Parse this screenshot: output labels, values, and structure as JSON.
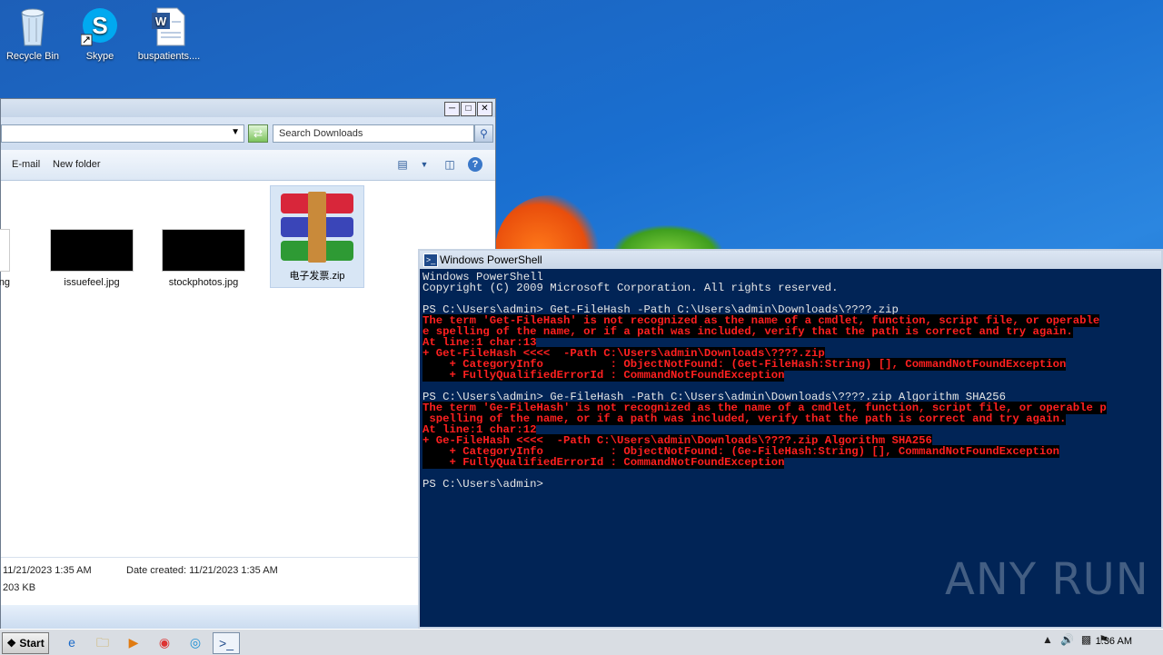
{
  "desktop": {
    "icons": [
      {
        "label": "Recycle Bin"
      },
      {
        "label": "Skype"
      },
      {
        "label": "buspatients...."
      }
    ]
  },
  "explorer": {
    "search_placeholder": "Search Downloads",
    "toolbar": {
      "email": "E-mail",
      "new_folder": "New folder"
    },
    "files": [
      {
        "name": "ng"
      },
      {
        "name": "issuefeel.jpg"
      },
      {
        "name": "stockphotos.jpg"
      },
      {
        "name": "电子发票.zip"
      }
    ],
    "details": {
      "date_modified": "11/21/2023 1:35 AM",
      "date_created": "Date created: 11/21/2023 1:35 AM",
      "size": "203 KB"
    }
  },
  "powershell": {
    "title": "Windows PowerShell",
    "lines": [
      {
        "text": "Windows PowerShell",
        "err": false
      },
      {
        "text": "Copyright (C) 2009 Microsoft Corporation. All rights reserved.",
        "err": false
      },
      {
        "text": "",
        "err": false
      },
      {
        "text": "PS C:\\Users\\admin> Get-FileHash -Path C:\\Users\\admin\\Downloads\\????.zip",
        "err": false
      },
      {
        "text": "The term 'Get-FileHash' is not recognized as the name of a cmdlet, function, script file, or operable",
        "err": true
      },
      {
        "text": "e spelling of the name, or if a path was included, verify that the path is correct and try again.",
        "err": true
      },
      {
        "text": "At line:1 char:13",
        "err": true
      },
      {
        "text": "+ Get-FileHash <<<<  -Path C:\\Users\\admin\\Downloads\\????.zip",
        "err": true
      },
      {
        "text": "    + CategoryInfo          : ObjectNotFound: (Get-FileHash:String) [], CommandNotFoundException",
        "err": true
      },
      {
        "text": "    + FullyQualifiedErrorId : CommandNotFoundException",
        "err": true
      },
      {
        "text": "",
        "err": false
      },
      {
        "text": "PS C:\\Users\\admin> Ge-FileHash -Path C:\\Users\\admin\\Downloads\\????.zip Algorithm SHA256",
        "err": false
      },
      {
        "text": "The term 'Ge-FileHash' is not recognized as the name of a cmdlet, function, script file, or operable p",
        "err": true
      },
      {
        "text": " spelling of the name, or if a path was included, verify that the path is correct and try again.",
        "err": true
      },
      {
        "text": "At line:1 char:12",
        "err": true
      },
      {
        "text": "+ Ge-FileHash <<<<  -Path C:\\Users\\admin\\Downloads\\????.zip Algorithm SHA256",
        "err": true
      },
      {
        "text": "    + CategoryInfo          : ObjectNotFound: (Ge-FileHash:String) [], CommandNotFoundException",
        "err": true
      },
      {
        "text": "    + FullyQualifiedErrorId : CommandNotFoundException",
        "err": true
      },
      {
        "text": "",
        "err": false
      },
      {
        "text": "PS C:\\Users\\admin>",
        "err": false
      }
    ]
  },
  "taskbar": {
    "start_label": "Start",
    "clock": "1:36 AM"
  },
  "watermark": "ANY RUN",
  "colors": {
    "ps_bg": "#012456",
    "error": "#ff2020",
    "desktop": "#1a6fd0"
  }
}
